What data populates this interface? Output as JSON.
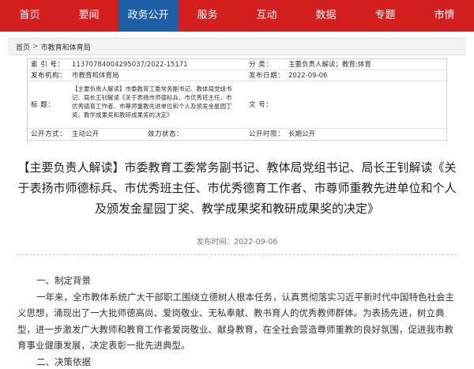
{
  "nav": {
    "items": [
      "首页",
      "要闻",
      "政务公开",
      "服务",
      "互动",
      "数据",
      "专题",
      "市情"
    ],
    "active_index": 2,
    "accent_color": "#d41f1f",
    "active_color": "#1f5fa8"
  },
  "breadcrumb": [
    "首页",
    "市教育和体育局"
  ],
  "info": {
    "index_label": "索 引 号：",
    "index_value": "11370784004295037/2022-15171",
    "category_label": "分    类：",
    "category_value": "主要负责人解读；教育;体育",
    "publisher_label": "发布机构：",
    "publisher_value": "市教育和体育局",
    "date_label": "发布日期：",
    "date_value": "2022-09-06",
    "title_label": "标    题：",
    "title_value": "【主要负责人解读】市委教育工委常务副书记、教体局党组书记、局长王钊解读《关于表扬市师德标兵、市优秀班主任、市优秀德育工作者、市尊师重教先进单位和个人及颁发金星园丁奖、教学成果奖和教研成果奖的决定》",
    "docno_label": "文    号：",
    "docno_value": "",
    "open_label": "公开方式：",
    "open_value": "主动公开",
    "validity_label": "效力状态：",
    "validity_value": "",
    "period_label": "公开时限：",
    "period_value": "长期公开"
  },
  "article": {
    "title": "【主要负责人解读】市委教育工委常务副书记、教体局党组书记、局长王钊解读《关于表扬市师德标兵、市优秀班主任、市优秀德育工作者、市尊师重教先进单位和个人及颁发金星园丁奖、教学成果奖和教研成果奖的决定》",
    "publish_date": "发布时间：2022-09-06",
    "section1_heading": "一、制定背景",
    "section1_body": "一年来，全市教体系统广大干部职工围绕立德树人根本任务，认真贯彻落实习近平新时代中国特色社会主义思想，涌现出了一大批师德高尚、爱岗敬业、无私奉献、教书育人的优秀教师群体。为表扬先进，树立典型，进一步激发广大教师和教育工作者爱岗敬业、献身教育，在全社会营造尊师重教的良好氛围，促进我市教育事业健康发展，决定表彰一批先进典型。",
    "section2_heading": "二、决策依据"
  }
}
